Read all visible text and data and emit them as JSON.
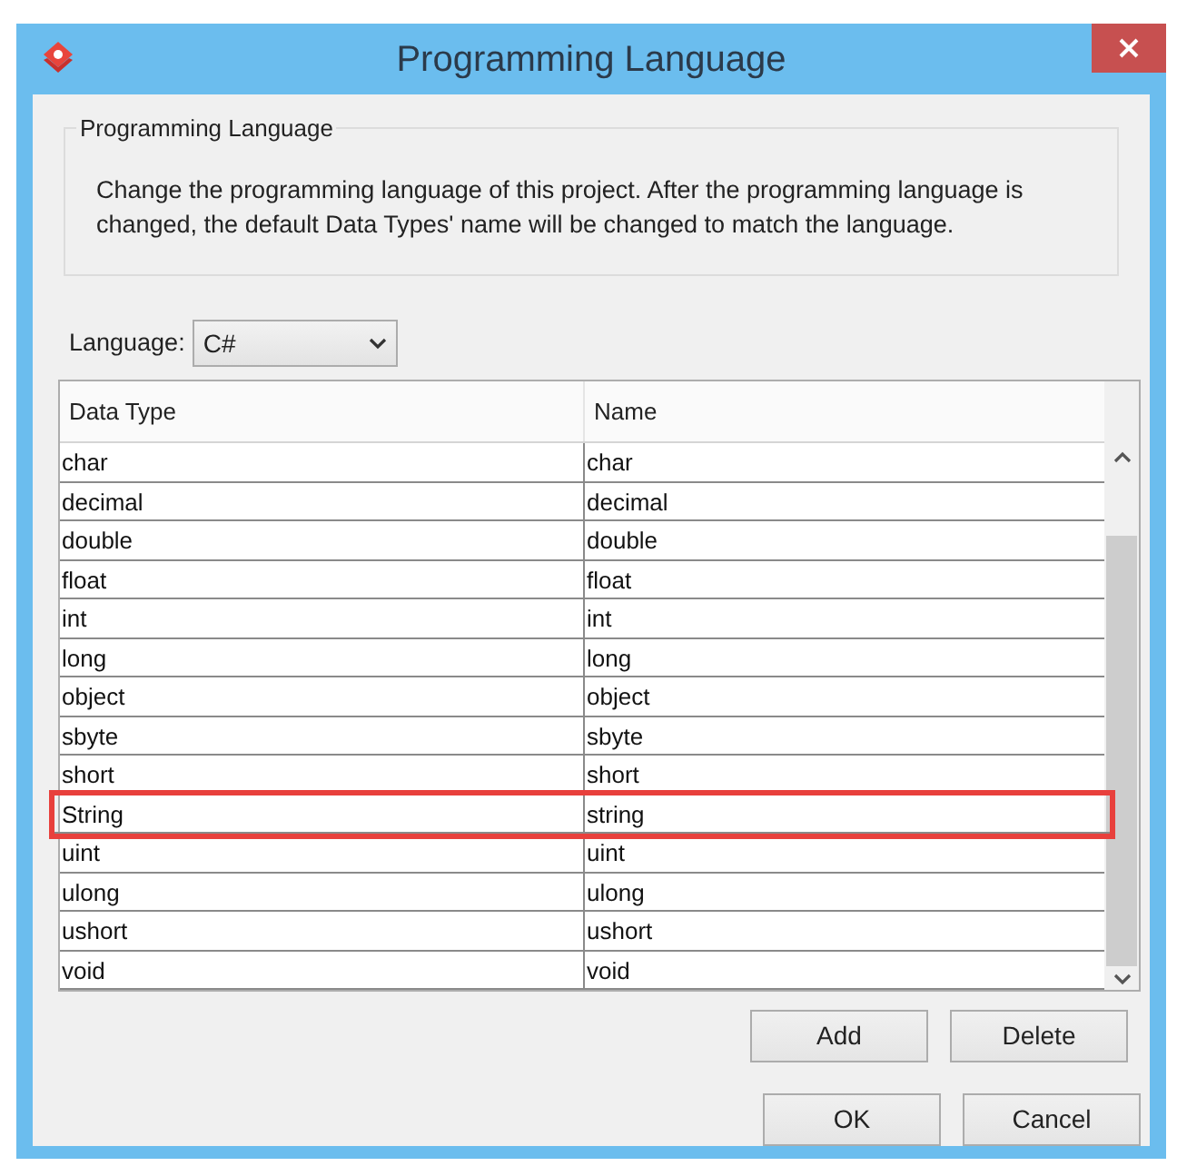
{
  "window": {
    "title": "Programming Language"
  },
  "group": {
    "title": "Programming Language",
    "description": "Change the programming language of this project. After the programming language is changed, the default Data Types' name will be changed to match the language."
  },
  "language": {
    "label": "Language:",
    "value": "C#"
  },
  "table": {
    "columns": [
      "Data Type",
      "Name"
    ],
    "rows": [
      {
        "data_type": "char",
        "name": "char",
        "highlighted": false
      },
      {
        "data_type": "decimal",
        "name": "decimal",
        "highlighted": false
      },
      {
        "data_type": "double",
        "name": "double",
        "highlighted": false
      },
      {
        "data_type": "float",
        "name": "float",
        "highlighted": false
      },
      {
        "data_type": "int",
        "name": "int",
        "highlighted": false
      },
      {
        "data_type": "long",
        "name": "long",
        "highlighted": false
      },
      {
        "data_type": "object",
        "name": "object",
        "highlighted": false
      },
      {
        "data_type": "sbyte",
        "name": "sbyte",
        "highlighted": false
      },
      {
        "data_type": "short",
        "name": "short",
        "highlighted": false
      },
      {
        "data_type": "String",
        "name": "string",
        "highlighted": true
      },
      {
        "data_type": "uint",
        "name": "uint",
        "highlighted": false
      },
      {
        "data_type": "ulong",
        "name": "ulong",
        "highlighted": false
      },
      {
        "data_type": "ushort",
        "name": "ushort",
        "highlighted": false
      },
      {
        "data_type": "void",
        "name": "void",
        "highlighted": false
      }
    ]
  },
  "table_buttons": [
    "Add",
    "Delete"
  ],
  "dialog_buttons": [
    "OK",
    "Cancel"
  ]
}
